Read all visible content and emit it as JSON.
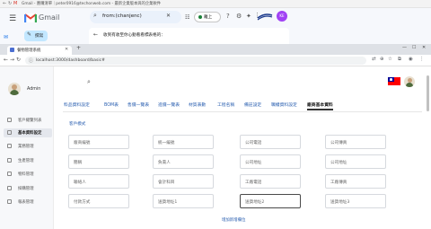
{
  "gmail_window": {
    "title_bar": "Gmail - 應購清單｜peter0916@techonweb.com - 最新企業版本與的企業軟件",
    "app_name": "Gmail",
    "search_query": "from:(chanjenc)",
    "status_label": "離上",
    "compose_label": "撰寫",
    "mail_preview": "收到有收至你心動看看標表格的：",
    "avatar_initials": "KE"
  },
  "browser": {
    "tab_title": "餐物管理系統",
    "url": "localhost:3000/dashboard/basic#"
  },
  "app": {
    "user": {
      "name": "Admin"
    },
    "sidebar": {
      "items": [
        {
          "label": "客戶總覽列表"
        },
        {
          "label": "基本資料設定"
        },
        {
          "label": "業務管理"
        },
        {
          "label": "生產管理"
        },
        {
          "label": "物料管理"
        },
        {
          "label": "採購管理"
        },
        {
          "label": "報表管理"
        }
      ]
    },
    "tabs": [
      {
        "label": "料品資料設定"
      },
      {
        "label": "BOM表"
      },
      {
        "label": "售價一覽表"
      },
      {
        "label": "進價一覽表"
      },
      {
        "label": "材質表數"
      },
      {
        "label": "工程名稱"
      },
      {
        "label": "備註設定"
      },
      {
        "label": "職權資料設定"
      },
      {
        "label": "廠商基本資料"
      }
    ],
    "section_title": "客戶模式",
    "fields": [
      {
        "placeholder": "廠商編號"
      },
      {
        "placeholder": "統一編號"
      },
      {
        "placeholder": "公司電話"
      },
      {
        "placeholder": "公司傳真"
      },
      {
        "placeholder": "簡稱"
      },
      {
        "placeholder": "負責人"
      },
      {
        "placeholder": "公司地址"
      },
      {
        "placeholder": "公司地址"
      },
      {
        "placeholder": "聯絡人"
      },
      {
        "placeholder": "會計科目"
      },
      {
        "placeholder": "工廠電話"
      },
      {
        "placeholder": "工廠傳真"
      },
      {
        "placeholder": "付款方式"
      },
      {
        "placeholder": "送貨地址1"
      },
      {
        "placeholder": "送貨地址2"
      },
      {
        "placeholder": "送貨地址3"
      }
    ],
    "add_link": "增加新增欄位"
  }
}
